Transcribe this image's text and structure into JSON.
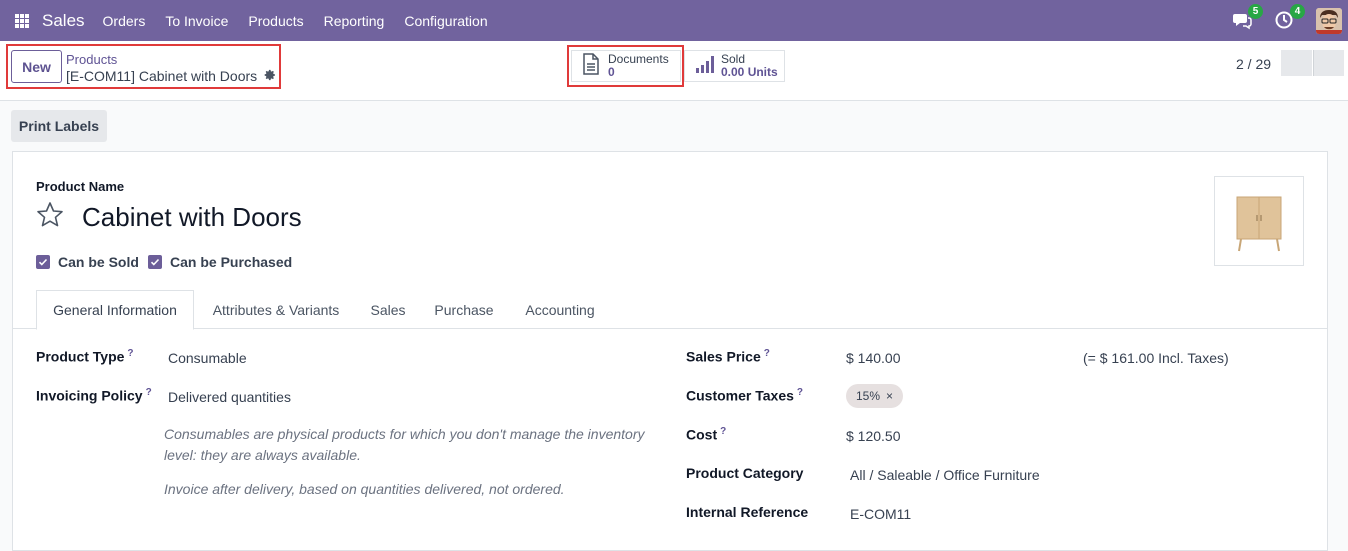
{
  "navbar": {
    "app_name": "Sales",
    "menu": [
      "Orders",
      "To Invoice",
      "Products",
      "Reporting",
      "Configuration"
    ],
    "messages_badge": "5",
    "activities_badge": "4"
  },
  "control": {
    "new_label": "New",
    "breadcrumb_parent": "Products",
    "breadcrumb_current": "[E-COM11] Cabinet with Doors",
    "documents_label": "Documents",
    "documents_value": "0",
    "sold_label": "Sold",
    "sold_value": "0.00 Units",
    "pager": "2 / 29",
    "print_labels": "Print Labels"
  },
  "product": {
    "name_label": "Product Name",
    "name": "Cabinet with Doors",
    "can_be_sold": "Can be Sold",
    "can_be_purchased": "Can be Purchased"
  },
  "tabs": [
    "General Information",
    "Attributes & Variants",
    "Sales",
    "Purchase",
    "Accounting"
  ],
  "general": {
    "product_type_label": "Product Type",
    "product_type": "Consumable",
    "invoicing_policy_label": "Invoicing Policy",
    "invoicing_policy": "Delivered quantities",
    "help1_line1": "Consumables are physical products for which you don't manage the inventory",
    "help1_line2": "level: they are always available.",
    "help2": "Invoice after delivery, based on quantities delivered, not ordered.",
    "sales_price_label": "Sales Price",
    "sales_price": "$ 140.00",
    "sales_price_incl": "(= $ 161.00 Incl. Taxes)",
    "customer_taxes_label": "Customer Taxes",
    "customer_tax_tag": "15%",
    "cost_label": "Cost",
    "cost": "$ 120.50",
    "category_label": "Product Category",
    "category": "All / Saleable / Office Furniture",
    "internal_ref_label": "Internal Reference",
    "internal_ref": "E-COM11",
    "help_mark": "?"
  },
  "colors": {
    "navbar": "#71639e",
    "accent": "#5f5394",
    "highlight": "#e03a3a",
    "badge": "#28a745"
  }
}
